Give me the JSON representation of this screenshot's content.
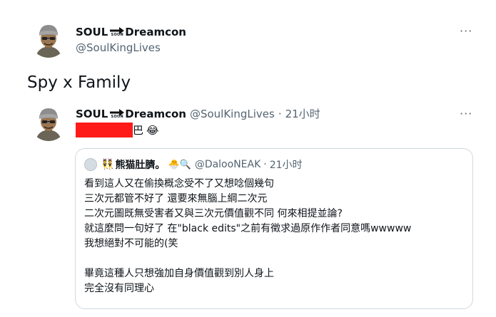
{
  "main_tweet": {
    "display_name": "SOUL",
    "display_name_suffix": "Dreamcon",
    "arrow_badge_text": "SOON",
    "handle": "@SoulKingLives",
    "more_label": "···",
    "text": "Spy x Family"
  },
  "reply": {
    "display_name": "SOUL",
    "display_name_suffix": "Dreamcon",
    "arrow_badge_text": "SOON",
    "handle": "@SoulKingLives",
    "separator": "·",
    "time": "21小时",
    "more_label": "···",
    "text_suffix": "巴",
    "emoji": "😂",
    "redaction_color": "#ff1a1a"
  },
  "quote": {
    "name_prefix_emoji": "👯",
    "display_name": "熊猫肚臍。",
    "name_emojis": "🐣🔍",
    "handle": "@DalooNEAK",
    "separator": "·",
    "time": "21小时",
    "lines": [
      "看到這人又在偷換概念受不了又想唸個幾句",
      "三次元都管不好了 還要來無腦上綱二次元",
      "二次元圖既無受害者又與三次元價值觀不同 何來相提並論?",
      "就這麼問一句好了 在\"black edits\"之前有徵求過原作作者同意嗎wwwww",
      "我想絕對不可能的(笑",
      "",
      "畢竟這種人只想強加自身價值觀到別人身上",
      "完全沒有同理心"
    ]
  },
  "colors": {
    "text_primary": "#0f1419",
    "text_secondary": "#536471",
    "border": "#cfd9de",
    "redaction": "#ff1a1a"
  }
}
